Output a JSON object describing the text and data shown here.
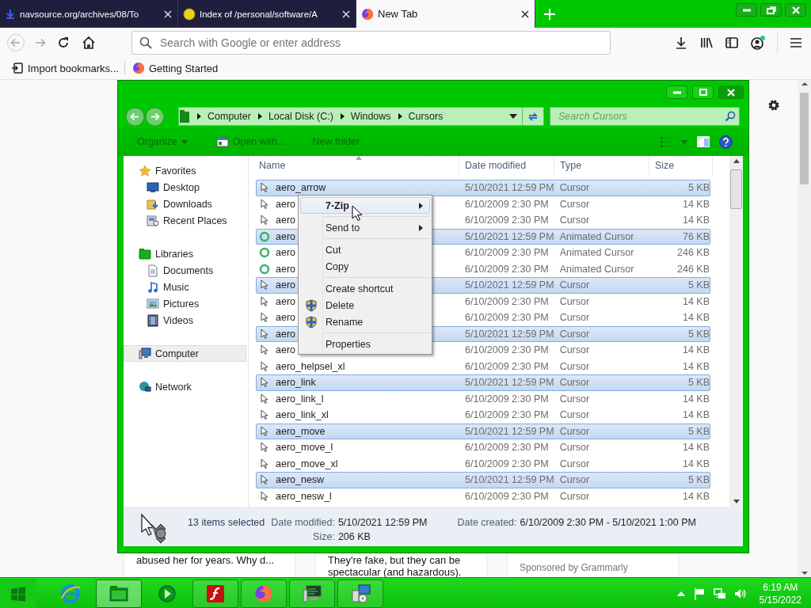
{
  "browser": {
    "tabs": [
      {
        "title": "navsource.org/archives/08/To",
        "selected": false,
        "kind": "site"
      },
      {
        "title": "Index of /personal/software/A",
        "selected": false,
        "kind": "dot"
      },
      {
        "title": "New Tab",
        "selected": true,
        "kind": "firefox"
      }
    ],
    "address": {
      "placeholder": "Search with Google or enter address"
    },
    "bookmarks": [
      {
        "label": "Import bookmarks...",
        "kind": "import"
      },
      {
        "label": "Getting Started",
        "kind": "firefox"
      }
    ]
  },
  "page": {
    "cards": [
      {
        "lines": [
          "abused her for years. Why d..."
        ]
      },
      {
        "lines": [
          "They're fake, but they can be",
          "spectacular (and hazardous)."
        ]
      },
      {
        "lines": [
          "Sponsored by Grammarly"
        ]
      }
    ]
  },
  "explorer": {
    "breadcrumb": [
      "Computer",
      "Local Disk (C:)",
      "Windows",
      "Cursors"
    ],
    "search": {
      "placeholder": "Search Cursors"
    },
    "toolbar": [
      {
        "label": "Organize",
        "kind": "menu"
      },
      {
        "label": "Open with...",
        "kind": "open"
      },
      {
        "label": "New folder",
        "kind": "plain"
      }
    ],
    "nav": [
      {
        "label": "Favorites",
        "kind": "star",
        "selected": false,
        "children": [
          {
            "label": "Desktop",
            "kind": "desktop",
            "selected": false
          },
          {
            "label": "Downloads",
            "kind": "downloads",
            "selected": false
          },
          {
            "label": "Recent Places",
            "kind": "recent",
            "selected": false
          }
        ]
      },
      {
        "label": "Libraries",
        "kind": "library",
        "selected": false,
        "children": [
          {
            "label": "Documents",
            "kind": "document",
            "selected": false
          },
          {
            "label": "Music",
            "kind": "music",
            "selected": false
          },
          {
            "label": "Pictures",
            "kind": "pictures",
            "selected": false
          },
          {
            "label": "Videos",
            "kind": "videos",
            "selected": false
          }
        ]
      },
      {
        "label": "Computer",
        "kind": "computer",
        "selected": true
      },
      {
        "label": "Network",
        "kind": "network",
        "selected": false
      }
    ],
    "columns": [
      "Name",
      "Date modified",
      "Type",
      "Size"
    ],
    "rows": [
      {
        "name": "aero_arrow",
        "date": "5/10/2021 12:59 PM",
        "type": "Cursor",
        "size": "5 KB",
        "kind": "static",
        "selected": true
      },
      {
        "name": "aero",
        "date": "6/10/2009 2:30 PM",
        "type": "Cursor",
        "size": "14 KB",
        "kind": "static",
        "selected": false
      },
      {
        "name": "aero",
        "date": "6/10/2009 2:30 PM",
        "type": "Cursor",
        "size": "14 KB",
        "kind": "static",
        "selected": false
      },
      {
        "name": "aero",
        "date": "5/10/2021 12:59 PM",
        "type": "Animated Cursor",
        "size": "76 KB",
        "kind": "animated",
        "selected": true
      },
      {
        "name": "aero",
        "date": "6/10/2009 2:30 PM",
        "type": "Animated Cursor",
        "size": "246 KB",
        "kind": "animated",
        "selected": false
      },
      {
        "name": "aero",
        "date": "6/10/2009 2:30 PM",
        "type": "Animated Cursor",
        "size": "246 KB",
        "kind": "animated",
        "selected": false
      },
      {
        "name": "aero",
        "date": "5/10/2021 12:59 PM",
        "type": "Cursor",
        "size": "5 KB",
        "kind": "static",
        "selected": true
      },
      {
        "name": "aero",
        "date": "6/10/2009 2:30 PM",
        "type": "Cursor",
        "size": "14 KB",
        "kind": "static",
        "selected": false
      },
      {
        "name": "aero",
        "date": "6/10/2009 2:30 PM",
        "type": "Cursor",
        "size": "14 KB",
        "kind": "static",
        "selected": false
      },
      {
        "name": "aero",
        "date": "5/10/2021 12:59 PM",
        "type": "Cursor",
        "size": "5 KB",
        "kind": "static",
        "selected": true
      },
      {
        "name": "aero",
        "date": "6/10/2009 2:30 PM",
        "type": "Cursor",
        "size": "14 KB",
        "kind": "static",
        "selected": false
      },
      {
        "name": "aero_helpsel_xl",
        "date": "6/10/2009 2:30 PM",
        "type": "Cursor",
        "size": "14 KB",
        "kind": "static",
        "selected": false
      },
      {
        "name": "aero_link",
        "date": "5/10/2021 12:59 PM",
        "type": "Cursor",
        "size": "5 KB",
        "kind": "static",
        "selected": true
      },
      {
        "name": "aero_link_l",
        "date": "6/10/2009 2:30 PM",
        "type": "Cursor",
        "size": "14 KB",
        "kind": "static",
        "selected": false
      },
      {
        "name": "aero_link_xl",
        "date": "6/10/2009 2:30 PM",
        "type": "Cursor",
        "size": "14 KB",
        "kind": "static",
        "selected": false
      },
      {
        "name": "aero_move",
        "date": "5/10/2021 12:59 PM",
        "type": "Cursor",
        "size": "5 KB",
        "kind": "static",
        "selected": true
      },
      {
        "name": "aero_move_l",
        "date": "6/10/2009 2:30 PM",
        "type": "Cursor",
        "size": "14 KB",
        "kind": "static",
        "selected": false
      },
      {
        "name": "aero_move_xl",
        "date": "6/10/2009 2:30 PM",
        "type": "Cursor",
        "size": "14 KB",
        "kind": "static",
        "selected": false
      },
      {
        "name": "aero_nesw",
        "date": "5/10/2021 12:59 PM",
        "type": "Cursor",
        "size": "5 KB",
        "kind": "static",
        "selected": true
      },
      {
        "name": "aero_nesw_l",
        "date": "6/10/2009 2:30 PM",
        "type": "Cursor",
        "size": "14 KB",
        "kind": "static",
        "selected": false
      }
    ],
    "context_menu": [
      {
        "kind": "item",
        "label": "7-Zip",
        "submenu": true,
        "shield": false,
        "selected": true
      },
      {
        "kind": "separator"
      },
      {
        "kind": "item",
        "label": "Send to",
        "submenu": true,
        "shield": false,
        "selected": false
      },
      {
        "kind": "separator"
      },
      {
        "kind": "item",
        "label": "Cut",
        "submenu": false,
        "shield": false,
        "selected": false
      },
      {
        "kind": "item",
        "label": "Copy",
        "submenu": false,
        "shield": false,
        "selected": false
      },
      {
        "kind": "separator"
      },
      {
        "kind": "item",
        "label": "Create shortcut",
        "submenu": false,
        "shield": false,
        "selected": false
      },
      {
        "kind": "item",
        "label": "Delete",
        "submenu": false,
        "shield": true,
        "selected": false
      },
      {
        "kind": "item",
        "label": "Rename",
        "submenu": false,
        "shield": true,
        "selected": false
      },
      {
        "kind": "separator"
      },
      {
        "kind": "item",
        "label": "Properties",
        "submenu": false,
        "shield": false,
        "selected": false
      }
    ],
    "status": {
      "summary": "13 items selected",
      "fields": [
        {
          "label": "Date modified:",
          "value": "5/10/2021 12:59 PM"
        },
        {
          "label": "Date created:",
          "value": "6/10/2009 2:30 PM - 5/10/2021 1:00 PM"
        },
        {
          "label": "Size:",
          "value": "206 KB"
        }
      ]
    }
  },
  "taskbar": {
    "apps": [
      {
        "kind": "ie",
        "running": false,
        "selected": false
      },
      {
        "kind": "explorer",
        "running": true,
        "selected": true
      },
      {
        "kind": "media",
        "running": false,
        "selected": false
      },
      {
        "kind": "flash",
        "running": true,
        "selected": false
      },
      {
        "kind": "firefox",
        "running": true,
        "selected": false
      },
      {
        "kind": "computer",
        "running": true,
        "selected": false
      },
      {
        "kind": "network",
        "running": true,
        "selected": false
      }
    ],
    "clock": {
      "time": "6:19 AM",
      "date": "5/15/2022"
    }
  }
}
